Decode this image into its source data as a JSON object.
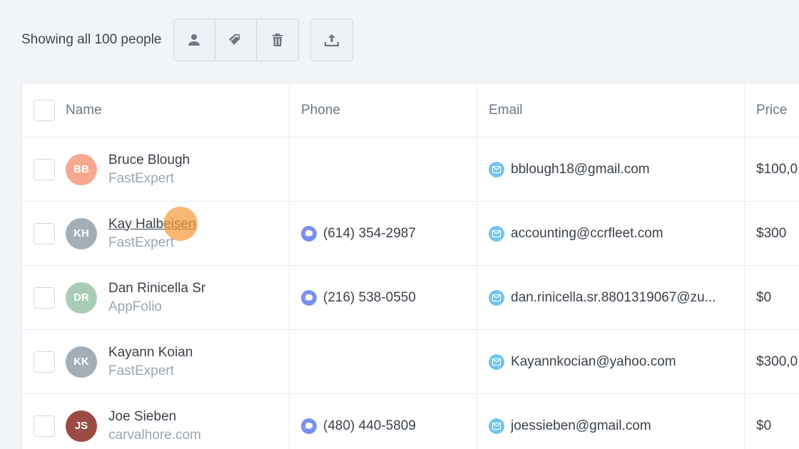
{
  "toolbar": {
    "showing_text": "Showing all 100 people",
    "buttons": [
      "person-icon",
      "tags-icon",
      "trash-icon"
    ],
    "export_icon": "upload-icon"
  },
  "table": {
    "columns": [
      "Name",
      "Phone",
      "Email",
      "Price"
    ],
    "rows": [
      {
        "initials": "BB",
        "avatar_color": "#f8a890",
        "name": "Bruce Blough",
        "company": "FastExpert",
        "phone": "",
        "email": "bblough18@gmail.com",
        "price": "$100,0"
      },
      {
        "initials": "KH",
        "avatar_color": "#a4aeb6",
        "name": "Kay Halbeisen",
        "company": "FastExpert",
        "phone": "(614) 354-2987",
        "email": "accounting@ccrfleet.com",
        "price": "$300"
      },
      {
        "initials": "DR",
        "avatar_color": "#a9ccb6",
        "name": "Dan Rinicella Sr",
        "company": "AppFolio",
        "phone": "(216) 538-0550",
        "email": "dan.rinicella.sr.8801319067@zu...",
        "price": "$0"
      },
      {
        "initials": "KK",
        "avatar_color": "#a4aeb6",
        "name": "Kayann Koian",
        "company": "FastExpert",
        "phone": "",
        "email": "Kayannkocian@yahoo.com",
        "price": "$300,0"
      },
      {
        "initials": "JS",
        "avatar_color": "#9c4a44",
        "name": "Joe Sieben",
        "company": "carvalhore.com",
        "phone": "(480) 440-5809",
        "email": "joessieben@gmail.com",
        "price": "$0"
      }
    ]
  },
  "colors": {
    "accent_phone": "#7b8ff0",
    "accent_mail": "#6ec6f0",
    "cursor": "#f59b3c"
  }
}
